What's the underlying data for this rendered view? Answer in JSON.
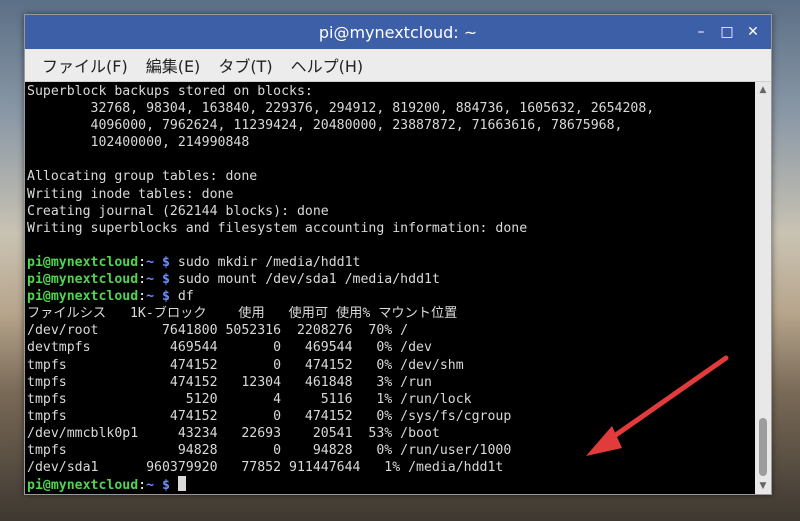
{
  "window": {
    "title": "pi@mynextcloud: ~",
    "buttons": [
      "–",
      "□",
      "✕"
    ]
  },
  "menu": [
    "ファイル(F)",
    "編集(E)",
    "タブ(T)",
    "ヘルプ(H)"
  ],
  "terminal_lines": [
    {
      "text": "Superblock backups stored on blocks:"
    },
    {
      "text": "        32768, 98304, 163840, 229376, 294912, 819200, 884736, 1605632, 2654208,"
    },
    {
      "text": "        4096000, 7962624, 11239424, 20480000, 23887872, 71663616, 78675968,"
    },
    {
      "text": "        102400000, 214990848"
    },
    {
      "text": ""
    },
    {
      "text": "Allocating group tables: done"
    },
    {
      "text": "Writing inode tables: done"
    },
    {
      "text": "Creating journal (262144 blocks): done"
    },
    {
      "text": "Writing superblocks and filesystem accounting information: done"
    },
    {
      "text": ""
    },
    {
      "user": "pi@mynextcloud",
      "sep": ":",
      "path": "~ $",
      "cmd": " sudo mkdir /media/hdd1t"
    },
    {
      "user": "pi@mynextcloud",
      "sep": ":",
      "path": "~ $",
      "cmd": " sudo mount /dev/sda1 /media/hdd1t"
    },
    {
      "user": "pi@mynextcloud",
      "sep": ":",
      "path": "~ $",
      "cmd": " df"
    },
    {
      "text": "ファイルシス   1K-ブロック    使用   使用可 使用% マウント位置"
    },
    {
      "text": "/dev/root        7641800 5052316  2208276  70% /"
    },
    {
      "text": "devtmpfs          469544       0   469544   0% /dev"
    },
    {
      "text": "tmpfs             474152       0   474152   0% /dev/shm"
    },
    {
      "text": "tmpfs             474152   12304   461848   3% /run"
    },
    {
      "text": "tmpfs               5120       4     5116   1% /run/lock"
    },
    {
      "text": "tmpfs             474152       0   474152   0% /sys/fs/cgroup"
    },
    {
      "text": "/dev/mmcblk0p1     43234   22693    20541  53% /boot"
    },
    {
      "text": "tmpfs              94828       0    94828   0% /run/user/1000"
    },
    {
      "text": "/dev/sda1      960379920   77852 911447644   1% /media/hdd1t"
    },
    {
      "user": "pi@mynextcloud",
      "sep": ":",
      "path": "~ $",
      "cmd": " ",
      "cursor": true
    }
  ],
  "colors": {
    "titlebar": "#3c5fa8",
    "prompt_user": "#4fd44f",
    "prompt_path": "#6f8cff",
    "arrow": "#e23b3b"
  }
}
